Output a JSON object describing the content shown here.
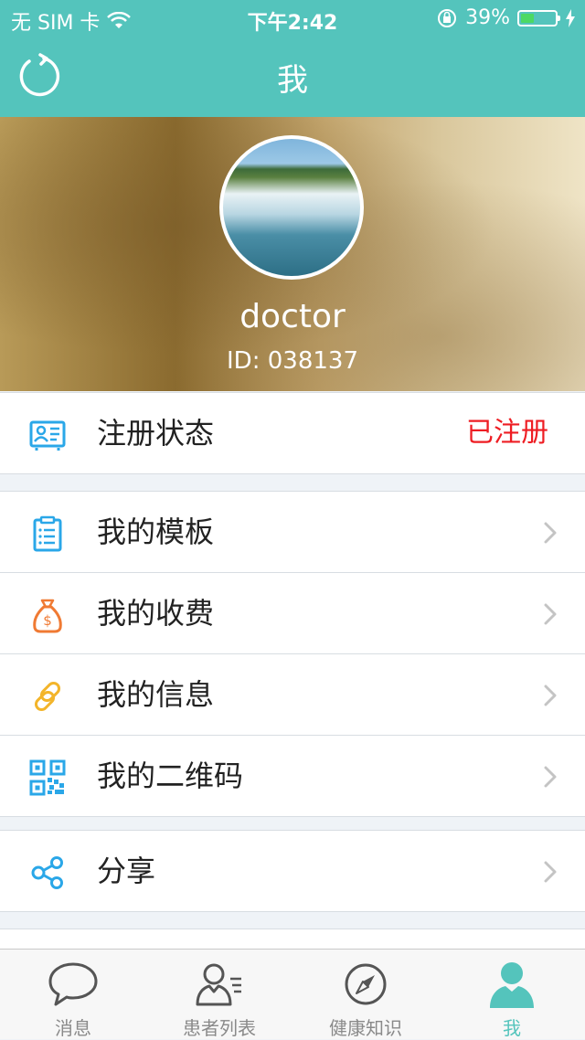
{
  "status_bar": {
    "carrier": "无 SIM 卡",
    "time": "下午2:42",
    "battery": "39%",
    "battery_level": 0.39
  },
  "nav": {
    "title": "我"
  },
  "profile": {
    "username": "doctor",
    "id_text": "ID: 038137"
  },
  "registration": {
    "label": "注册状态",
    "value": "已注册"
  },
  "menu": [
    {
      "label": "我的模板",
      "icon": "clipboard-icon"
    },
    {
      "label": "我的收费",
      "icon": "money-bag-icon"
    },
    {
      "label": "我的信息",
      "icon": "link-icon"
    },
    {
      "label": "我的二维码",
      "icon": "qrcode-icon"
    }
  ],
  "share": {
    "label": "分享",
    "icon": "share-icon"
  },
  "tabs": [
    {
      "label": "消息",
      "icon": "chat-bubble-icon"
    },
    {
      "label": "患者列表",
      "icon": "patient-list-icon"
    },
    {
      "label": "健康知识",
      "icon": "compass-icon"
    },
    {
      "label": "我",
      "icon": "profile-icon",
      "active": true
    }
  ],
  "colors": {
    "accent": "#54c4bc",
    "registered": "#ee1d23",
    "icon_blue": "#2aa7e8",
    "icon_orange": "#f07a33",
    "icon_yellow": "#f3b52b"
  }
}
